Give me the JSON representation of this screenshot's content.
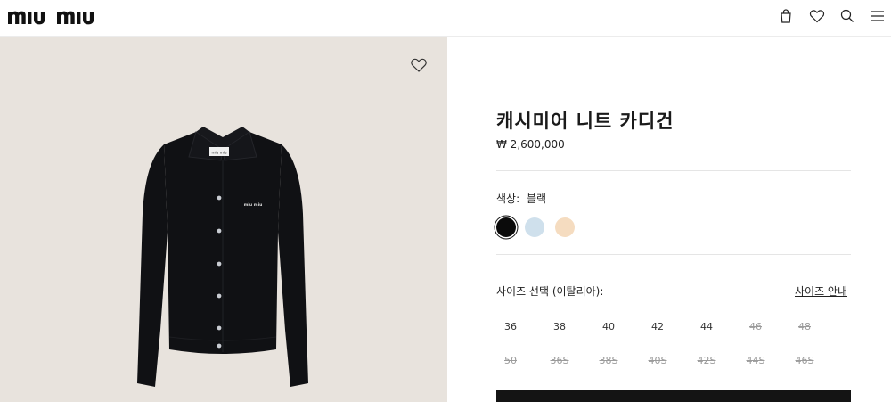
{
  "header": {
    "brand": "MIU MIU",
    "icons": [
      "bag-icon",
      "heart-icon",
      "search-icon",
      "menu-icon"
    ]
  },
  "image_panel": {
    "background_color": "#e8e3dd",
    "wishlist_icon": "heart-outline-icon",
    "garment_label_text": "miu miu"
  },
  "product": {
    "title": "캐시미어 니트 카디건",
    "price": "₩ 2,600,000",
    "color_label": "색상:",
    "color_value": "블랙",
    "colors": [
      {
        "name": "black",
        "hex": "#0b0b0b",
        "selected": true
      },
      {
        "name": "light-blue",
        "hex": "#cfe0ec",
        "selected": false
      },
      {
        "name": "beige",
        "hex": "#f5dcc0",
        "selected": false
      }
    ],
    "size_label": "사이즈 선택 (이탈리아):",
    "size_guide": "사이즈 안내",
    "sizes": [
      {
        "label": "36",
        "available": true
      },
      {
        "label": "38",
        "available": true
      },
      {
        "label": "40",
        "available": true
      },
      {
        "label": "42",
        "available": true
      },
      {
        "label": "44",
        "available": true
      },
      {
        "label": "46",
        "available": false
      },
      {
        "label": "48",
        "available": false
      },
      {
        "label": "50",
        "available": false
      },
      {
        "label": "36S",
        "available": false
      },
      {
        "label": "38S",
        "available": false
      },
      {
        "label": "40S",
        "available": false
      },
      {
        "label": "42S",
        "available": false
      },
      {
        "label": "44S",
        "available": false
      },
      {
        "label": "46S",
        "available": false
      }
    ]
  }
}
